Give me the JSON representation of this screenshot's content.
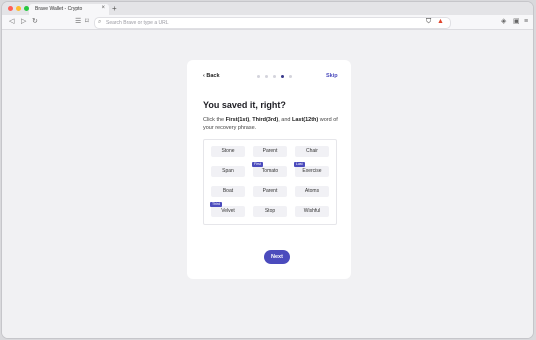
{
  "browser": {
    "tab_title": "Brave Wallet - Crypto",
    "tab_close": "×",
    "new_tab": "+",
    "url_placeholder": "Search Brave or type a URL",
    "traffic_colors": [
      "#ff5f57",
      "#febc2e",
      "#28c840"
    ]
  },
  "onboarding": {
    "back_label": "Back",
    "skip_label": "Skip",
    "steps_total": 5,
    "steps_active": 4,
    "title": "You saved it, right?",
    "desc_prefix": "Click the ",
    "desc_first": "First(1st)",
    "desc_sep1": ", ",
    "desc_third": "Third(3rd)",
    "desc_sep2": ", and ",
    "desc_last": "Last(12th)",
    "desc_suffix": " word of your recovery phrase.",
    "words": [
      {
        "text": "Stone",
        "badge": ""
      },
      {
        "text": "Parent",
        "badge": ""
      },
      {
        "text": "Chair",
        "badge": ""
      },
      {
        "text": "Span",
        "badge": ""
      },
      {
        "text": "Tomato",
        "badge": "First"
      },
      {
        "text": "Exercise",
        "badge": "Last"
      },
      {
        "text": "Boat",
        "badge": ""
      },
      {
        "text": "Parent",
        "badge": ""
      },
      {
        "text": "Atoms",
        "badge": ""
      },
      {
        "text": "Velvet",
        "badge": "Third"
      },
      {
        "text": "Stop",
        "badge": ""
      },
      {
        "text": "Wishful",
        "badge": ""
      }
    ],
    "next_label": "Next",
    "accent": "#4b4bbd"
  }
}
